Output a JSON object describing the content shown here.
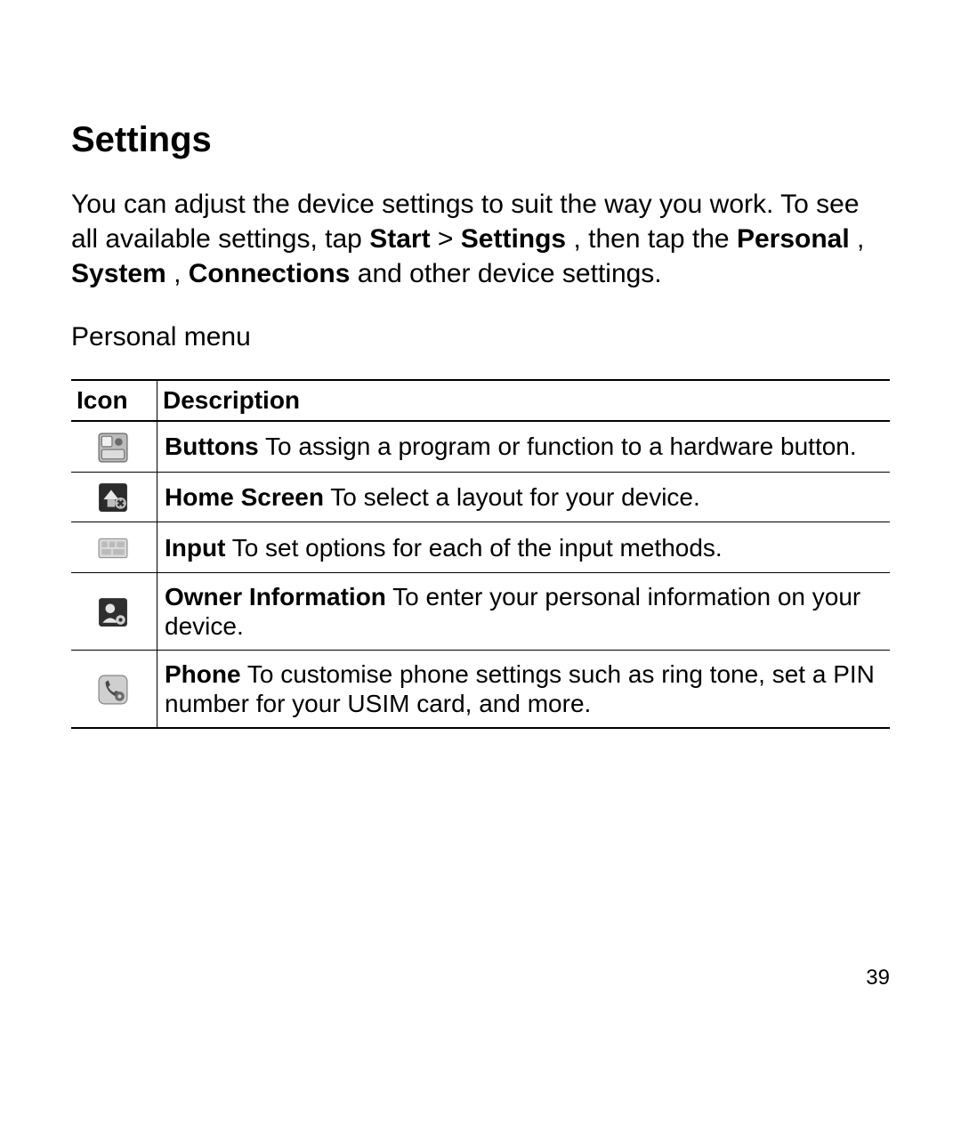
{
  "heading": "Settings",
  "intro": {
    "part1": "You can adjust the device settings to suit the way you work. To see all available settings, tap ",
    "b1": "Start",
    "gt": " > ",
    "b2": "Settings",
    "part2": ", then tap the ",
    "b3": "Personal",
    "comma1": ", ",
    "b4": "System",
    "comma2": ", ",
    "b5": "Connections",
    "part3": " and other device settings."
  },
  "subhead": "Personal menu",
  "table": {
    "headers": {
      "icon": "Icon",
      "desc": "Description"
    },
    "rows": [
      {
        "icon_name": "buttons-icon",
        "bold": "Buttons",
        "rest": " To assign a program or function to a hardware button."
      },
      {
        "icon_name": "home-screen-icon",
        "bold": "Home Screen",
        "rest": " To select a layout for your device."
      },
      {
        "icon_name": "input-icon",
        "bold": "Input",
        "rest": " To set options for each of the input methods."
      },
      {
        "icon_name": "owner-info-icon",
        "bold": "Owner Information",
        "rest": " To enter your personal information on your device."
      },
      {
        "icon_name": "phone-settings-icon",
        "bold": "Phone",
        "rest": " To customise phone settings such as ring tone, set a PIN number for your USIM card, and more."
      }
    ]
  },
  "page_number": "39"
}
